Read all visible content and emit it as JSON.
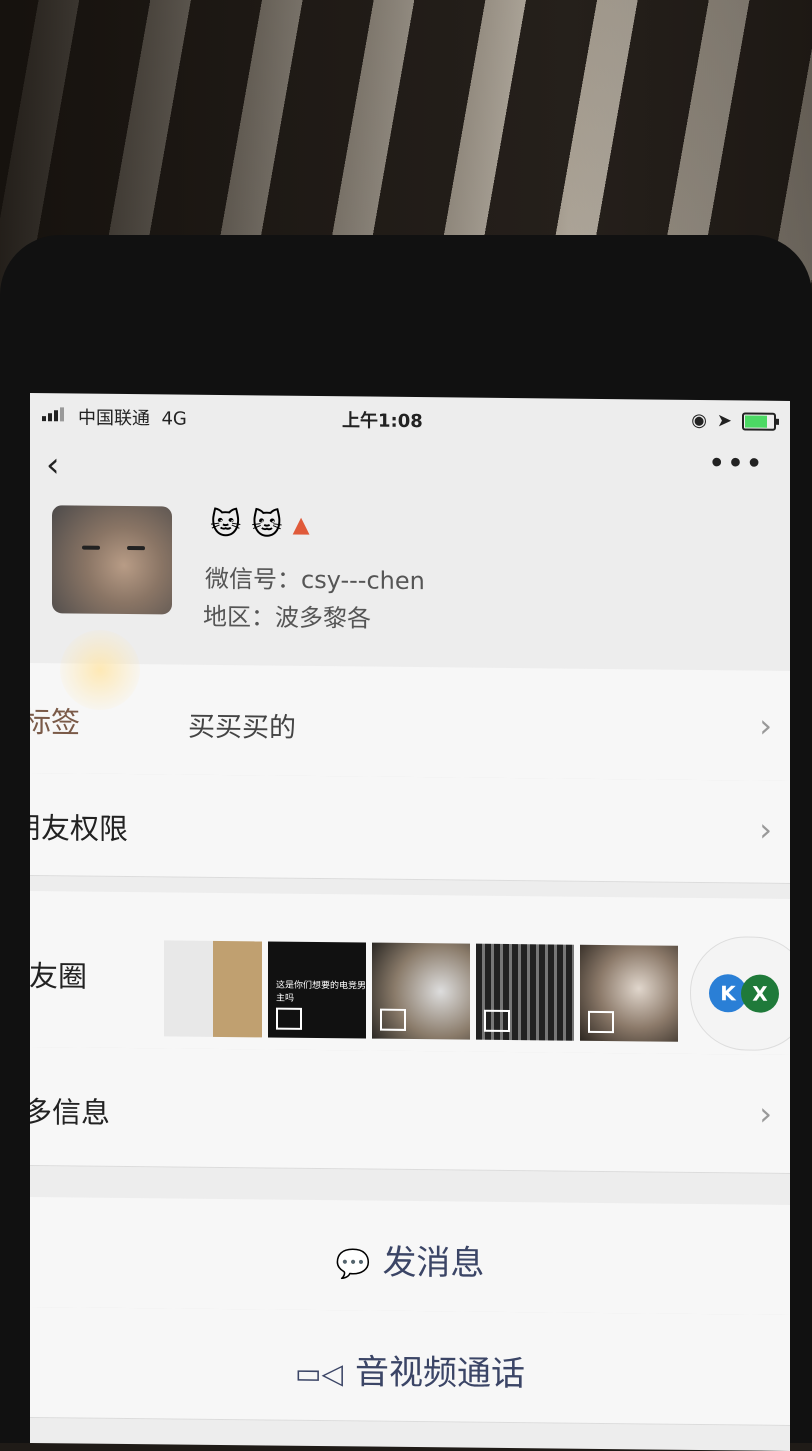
{
  "status_bar": {
    "carrier": "中国联通",
    "network": "4G",
    "time": "上午1:08",
    "battery_color": "#4cd964"
  },
  "nav": {
    "back_icon": "‹",
    "more_icon": "•••"
  },
  "profile": {
    "nickname_emoji": [
      "🐱",
      "🐱"
    ],
    "gender_icon": "person-icon",
    "wechat_id": "微信号：csy---chen",
    "region": "地区：波多黎各"
  },
  "rows": {
    "tags_label": "标签",
    "tags_value": "买买买的",
    "friend_permissions_label": "朋友权限",
    "moments_label": "朋友圈",
    "more_info_label": "更多信息"
  },
  "moments": {
    "thumb_caption": "这是你们想要的电竞男主吗",
    "floating_badges": [
      "K",
      "X"
    ]
  },
  "actions": {
    "send_message": "发消息",
    "video_call": "音视频通话"
  }
}
